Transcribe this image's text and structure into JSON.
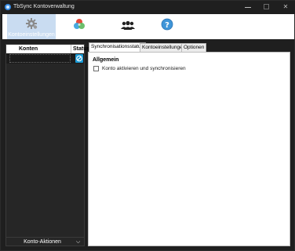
{
  "window": {
    "title": "TbSync Kontoverwaltung"
  },
  "toolbar": {
    "items": [
      {
        "label": "Kontoeinstellungen",
        "icon": "gear-icon",
        "active": true
      },
      {
        "label": "",
        "icon": "color-circles-icon",
        "active": false
      },
      {
        "label": "",
        "icon": "users-icon",
        "active": false
      },
      {
        "label": "",
        "icon": "help-icon",
        "active": false
      }
    ]
  },
  "accounts": {
    "col_name": "Konten",
    "col_status": "Status",
    "actions_label": "Konto-Aktionen",
    "actions_chevron": "⌵"
  },
  "tabs": [
    {
      "label": "Synchronisationsstatus",
      "active": true
    },
    {
      "label": "Kontoeinstellungen",
      "active": false
    },
    {
      "label": "Optionen",
      "active": false
    }
  ],
  "panel": {
    "section_title": "Allgemein",
    "checkbox_label": "Konto aktivieren und synchronisieren",
    "checkbox_checked": false
  },
  "colors": {
    "accent": "#1a9ad6",
    "active_toolbar": "#c9dcf1",
    "window_bg": "#1f1f1f"
  }
}
